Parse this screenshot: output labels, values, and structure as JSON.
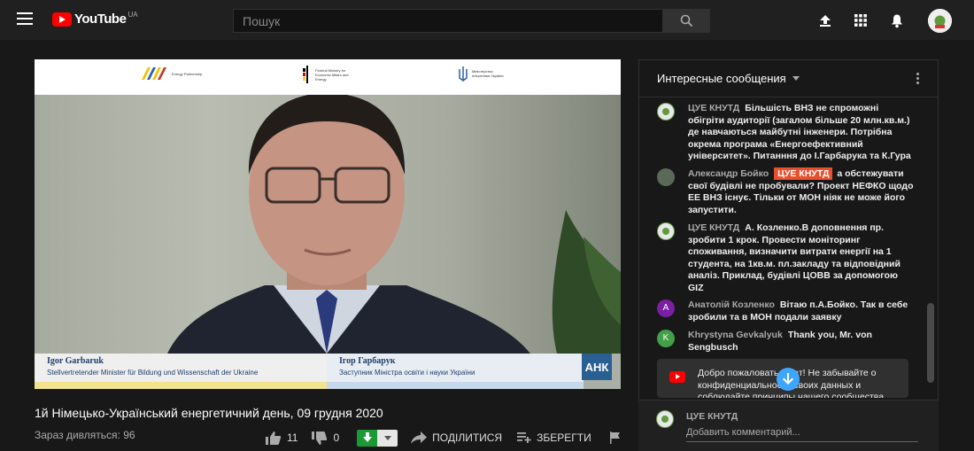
{
  "header": {
    "logo_text": "YouTube",
    "logo_region": "UA",
    "search_placeholder": "Пошук",
    "icons": [
      "menu-icon",
      "search-icon",
      "upload-icon",
      "apps-icon",
      "bell-icon"
    ]
  },
  "video": {
    "banner": {
      "logo1": "Energy Partnership",
      "logo2": "Federal Ministry for Economic Affairs and Energy",
      "logo3": "Міністерство енергетики України"
    },
    "speaker_de_name": "Igor Garbaruk",
    "speaker_de_role": "Stellvertretender Minister für Bildung und Wissenschaft der Ukraine",
    "speaker_ua_name": "Ігор Гарбарук",
    "speaker_ua_role": "Заступник Міністра освіти і науки України",
    "badge": "АНК"
  },
  "title": "1й Німецько-Український енергетичний день, 09 грудня 2020",
  "views": "Зараз дивляться: 96",
  "actions": {
    "likes": "11",
    "dislikes": "0",
    "share": "ПОДІЛИТИСЯ",
    "save": "ЗБЕРЕГТИ"
  },
  "chat": {
    "header": "Интересные сообщения",
    "messages": [
      {
        "author": "ЦУЕ КНУТД",
        "text": "Більшість ВНЗ не спроможні обігріти аудиторії (загалом більше 20 млн.кв.м.) де навчаються майбутні інженери. Потрібна окрема програма «Енергоефективний університет». Питанння до І.Гарбарука та К.Гура"
      },
      {
        "author": "Александр Бойко",
        "mention": "ЦУЕ КНУТД",
        "text": "а обстежувати свої будівлі не пробували? Проект НЕФКО щодо ЕЕ ВНЗ існує. Тільки от МОН ніяк не може його запустити."
      },
      {
        "author": "ЦУЕ КНУТД",
        "text": "А. Козленко.В доповнення пр. зробити 1 крок. Провести моніторинг споживання, визначити витрати енергії на 1 студента, на 1кв.м. пл.закладу та відповідний аналіз. Приклад, будівлі ЦОВВ за допомогою GIZ"
      },
      {
        "author": "Анатолій Козленко",
        "avatar_letter": "A",
        "text": "Вітаю п.А.Бойко. Так в себе зробили та в МОН подали заявку"
      },
      {
        "author": "Khrystyna Gevkalyuk",
        "avatar_letter": "K",
        "text": "Thank you, Mr. von Sengbusch"
      }
    ],
    "welcome": "Добро пожаловать в чат! Не забывайте о конфиденциальности своих данных и соблюдайте принципы нашего сообщества.",
    "input_name": "ЦУЕ КНУТД",
    "input_placeholder": "Добавить комментарий..."
  }
}
